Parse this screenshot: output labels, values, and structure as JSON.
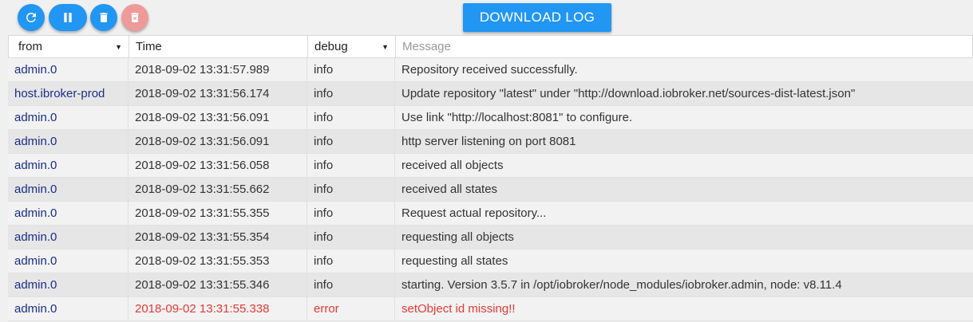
{
  "toolbar": {
    "refresh_icon": "refresh-icon",
    "pause_icon": "pause-icon",
    "delete_icon": "trash-icon",
    "clear_icon": "trash-x-icon",
    "download_label": "DOWNLOAD LOG"
  },
  "colors": {
    "accent": "#2196f3",
    "disabled": "#ef9a9a",
    "error": "#e53935",
    "source": "#1a2d8a"
  },
  "table": {
    "headers": {
      "from": "from",
      "time": "Time",
      "level": "debug",
      "message_placeholder": "Message"
    },
    "rows": [
      {
        "from": "admin.0",
        "time": "2018-09-02 13:31:57.989",
        "level": "info",
        "message": "Repository received successfully."
      },
      {
        "from": "host.ibroker-prod",
        "time": "2018-09-02 13:31:56.174",
        "level": "info",
        "message": "Update repository \"latest\" under \"http://download.iobroker.net/sources-dist-latest.json\""
      },
      {
        "from": "admin.0",
        "time": "2018-09-02 13:31:56.091",
        "level": "info",
        "message": "Use link \"http://localhost:8081\" to configure."
      },
      {
        "from": "admin.0",
        "time": "2018-09-02 13:31:56.091",
        "level": "info",
        "message": "http server listening on port 8081"
      },
      {
        "from": "admin.0",
        "time": "2018-09-02 13:31:56.058",
        "level": "info",
        "message": "received all objects"
      },
      {
        "from": "admin.0",
        "time": "2018-09-02 13:31:55.662",
        "level": "info",
        "message": "received all states"
      },
      {
        "from": "admin.0",
        "time": "2018-09-02 13:31:55.355",
        "level": "info",
        "message": "Request actual repository..."
      },
      {
        "from": "admin.0",
        "time": "2018-09-02 13:31:55.354",
        "level": "info",
        "message": "requesting all objects"
      },
      {
        "from": "admin.0",
        "time": "2018-09-02 13:31:55.353",
        "level": "info",
        "message": "requesting all states"
      },
      {
        "from": "admin.0",
        "time": "2018-09-02 13:31:55.346",
        "level": "info",
        "message": "starting. Version 3.5.7 in /opt/iobroker/node_modules/iobroker.admin, node: v8.11.4"
      },
      {
        "from": "admin.0",
        "time": "2018-09-02 13:31:55.338",
        "level": "error",
        "message": "setObject id missing!!"
      }
    ]
  }
}
